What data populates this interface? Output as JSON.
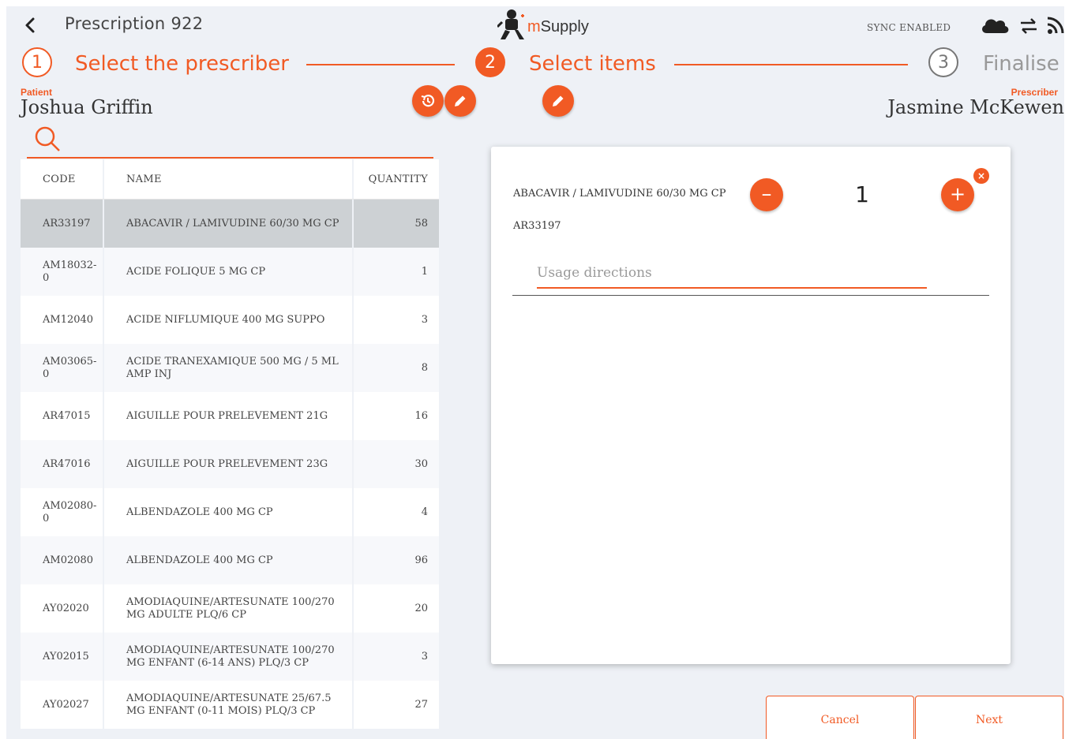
{
  "header": {
    "title": "Prescription 922",
    "logo_m": "m",
    "logo_text": "Supply",
    "sync_status": "SYNC ENABLED"
  },
  "stepper": {
    "steps": [
      {
        "number": "1",
        "label": "Select the prescriber",
        "state": "complete"
      },
      {
        "number": "2",
        "label": "Select items",
        "state": "active"
      },
      {
        "number": "3",
        "label": "Finalise",
        "state": "pending"
      }
    ]
  },
  "patient": {
    "label": "Patient",
    "name": "Joshua Griffin"
  },
  "prescriber": {
    "label": "Prescriber",
    "name": "Jasmine McKewen"
  },
  "table": {
    "columns": [
      "CODE",
      "NAME",
      "QUANTITY"
    ],
    "rows": [
      {
        "code": "AR33197",
        "name": "ABACAVIR / LAMIVUDINE 60/30 MG CP",
        "quantity": "58",
        "selected": true
      },
      {
        "code": "AM18032-0",
        "name": "ACIDE FOLIQUE 5 MG CP",
        "quantity": "1"
      },
      {
        "code": "AM12040",
        "name": "ACIDE NIFLUMIQUE 400 MG SUPPO",
        "quantity": "3"
      },
      {
        "code": "AM03065-0",
        "name": "ACIDE TRANEXAMIQUE 500 MG / 5 ML AMP INJ",
        "quantity": "8"
      },
      {
        "code": "AR47015",
        "name": "AIGUILLE POUR PRELEVEMENT 21G",
        "quantity": "16"
      },
      {
        "code": "AR47016",
        "name": "AIGUILLE POUR PRELEVEMENT 23G",
        "quantity": "30"
      },
      {
        "code": "AM02080-0",
        "name": "ALBENDAZOLE 400 MG CP",
        "quantity": "4"
      },
      {
        "code": "AM02080",
        "name": "ALBENDAZOLE 400 MG CP",
        "quantity": "96"
      },
      {
        "code": "AY02020",
        "name": "AMODIAQUINE/ARTESUNATE 100/270 MG ADULTE PLQ/6 CP",
        "quantity": "20"
      },
      {
        "code": "AY02015",
        "name": "AMODIAQUINE/ARTESUNATE 100/270 MG ENFANT (6-14 ANS) PLQ/3 CP",
        "quantity": "3"
      },
      {
        "code": "AY02027",
        "name": "AMODIAQUINE/ARTESUNATE 25/67.5 MG ENFANT (0-11 MOIS) PLQ/3 CP",
        "quantity": "27"
      }
    ]
  },
  "item_card": {
    "item_name": "ABACAVIR / LAMIVUDINE 60/30 MG CP",
    "item_code": "AR33197",
    "quantity": "1",
    "usage_placeholder": "Usage directions",
    "usage_value": ""
  },
  "footer": {
    "cancel_label": "Cancel",
    "next_label": "Next"
  },
  "colors": {
    "accent": "#f15a24",
    "background": "#eef1f6",
    "selected_row": "#cdd1d4"
  },
  "icons": [
    "back-chevron-icon",
    "msupply-logo",
    "cloud-icon",
    "sync-arrows-icon",
    "rss-feed-icon",
    "history-icon",
    "pencil-icon",
    "search-icon"
  ]
}
